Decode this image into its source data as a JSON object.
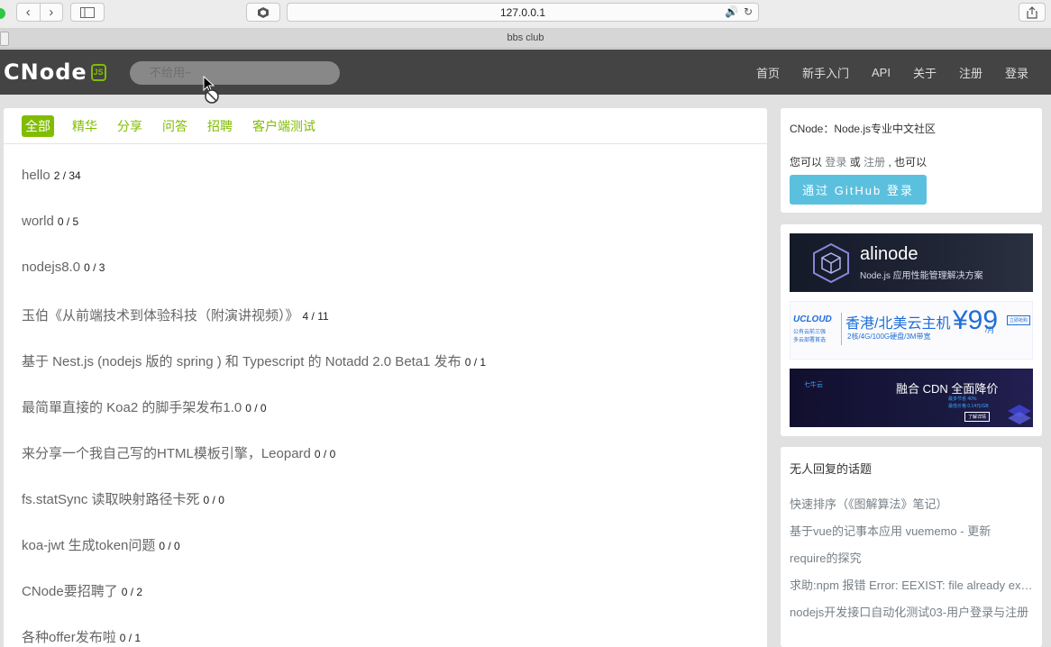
{
  "browser": {
    "url": "127.0.0.1",
    "tab_title": "bbs club",
    "back_icon": "chevron-left-icon",
    "forward_icon": "chevron-right-icon"
  },
  "navbar": {
    "logo_text": "CNode",
    "logo_badge": "JS",
    "search_placeholder": "不给用~",
    "menu": [
      "首页",
      "新手入门",
      "API",
      "关于",
      "注册",
      "登录"
    ]
  },
  "main": {
    "tabs": [
      "全部",
      "精华",
      "分享",
      "问答",
      "招聘",
      "客户端测试"
    ],
    "active_tab": "全部",
    "topics": [
      {
        "title": "hello",
        "count": "2 / 34"
      },
      {
        "title": "world",
        "count": "0 / 5"
      },
      {
        "title": "nodejs8.0",
        "count": "0 / 3"
      },
      {
        "title": "玉伯《从前端技术到体验科技（附演讲视频）》",
        "count": "4 / 11"
      },
      {
        "title": "基于 Nest.js (nodejs 版的 spring ) 和 Typescript 的 Notadd 2.0 Beta1 发布",
        "count": "0 / 1"
      },
      {
        "title": "最简單直接的 Koa2 的脚手架发布1.0",
        "count": "0 / 0"
      },
      {
        "title": "来分享一个我自己写的HTML模板引擎，Leopard",
        "count": "0 / 0"
      },
      {
        "title": "fs.statSync 读取映射路径卡死",
        "count": "0 / 0"
      },
      {
        "title": "koa-jwt 生成token问题",
        "count": "0 / 0"
      },
      {
        "title": "CNode要招聘了",
        "count": "0 / 2"
      },
      {
        "title": "各种offer发布啦",
        "count": "0 / 1"
      }
    ]
  },
  "sidebar": {
    "intro_title": "CNode：Node.js专业中文社区",
    "login_prefix": "您可以",
    "login_link": "登录",
    "login_or": "或",
    "register_link": "注册",
    "login_suffix": ", 也可以",
    "github_button": "通过 GitHub 登录",
    "ads": {
      "alinode_title": "alinode",
      "alinode_sub": "Node.js 应用性能管理解决方案",
      "ucloud_brand": "UCLOUD",
      "ucloud_brand_sub1": "公有云前三强",
      "ucloud_brand_sub2": "多云部署首选",
      "ucloud_title": "香港/北美云主机",
      "ucloud_spec": "2核/4G/100G硬盘/3M带宽",
      "ucloud_price": "¥99",
      "ucloud_unit": "/月",
      "ucloud_btn": "立即抢购",
      "qiniu_brand": "七牛云",
      "qiniu_title": "融合 CDN 全面降价",
      "qiniu_line1": "最多节省 40%",
      "qiniu_line2": "最低价格 0.14元/GB",
      "qiniu_btn": "了解详情"
    },
    "no_reply_title": "无人回复的话题",
    "no_reply_topics": [
      "快速排序（《图解算法》笔记）",
      "基于vue的记事本应用 vuememo - 更新",
      "require的探究",
      "求助:npm 报错 Error: EEXIST: file already exists",
      "nodejs开发接口自动化测试03-用户登录与注册"
    ]
  },
  "colors": {
    "brand": "#80bd01",
    "navbar": "#444444",
    "github_button": "#5bc0de"
  }
}
